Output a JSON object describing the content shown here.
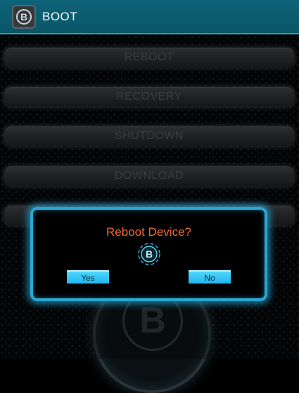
{
  "app": {
    "title": "BOOT",
    "logo_letter": "B"
  },
  "menu": [
    {
      "label": "REBOOT"
    },
    {
      "label": "RECOVERY"
    },
    {
      "label": "SHUTDOWN"
    },
    {
      "label": "DOWNLOAD"
    },
    {
      "label": ""
    }
  ],
  "emblem": {
    "letter": "B"
  },
  "dialog": {
    "title": "Reboot Device?",
    "icon": "boot-logo-icon",
    "yes_label": "Yes",
    "no_label": "No"
  },
  "colors": {
    "actionbar": "#0a5668",
    "accent": "#2ba6d1",
    "dialog_title": "#ee6a33",
    "dialog_button": "#22b6ee"
  }
}
